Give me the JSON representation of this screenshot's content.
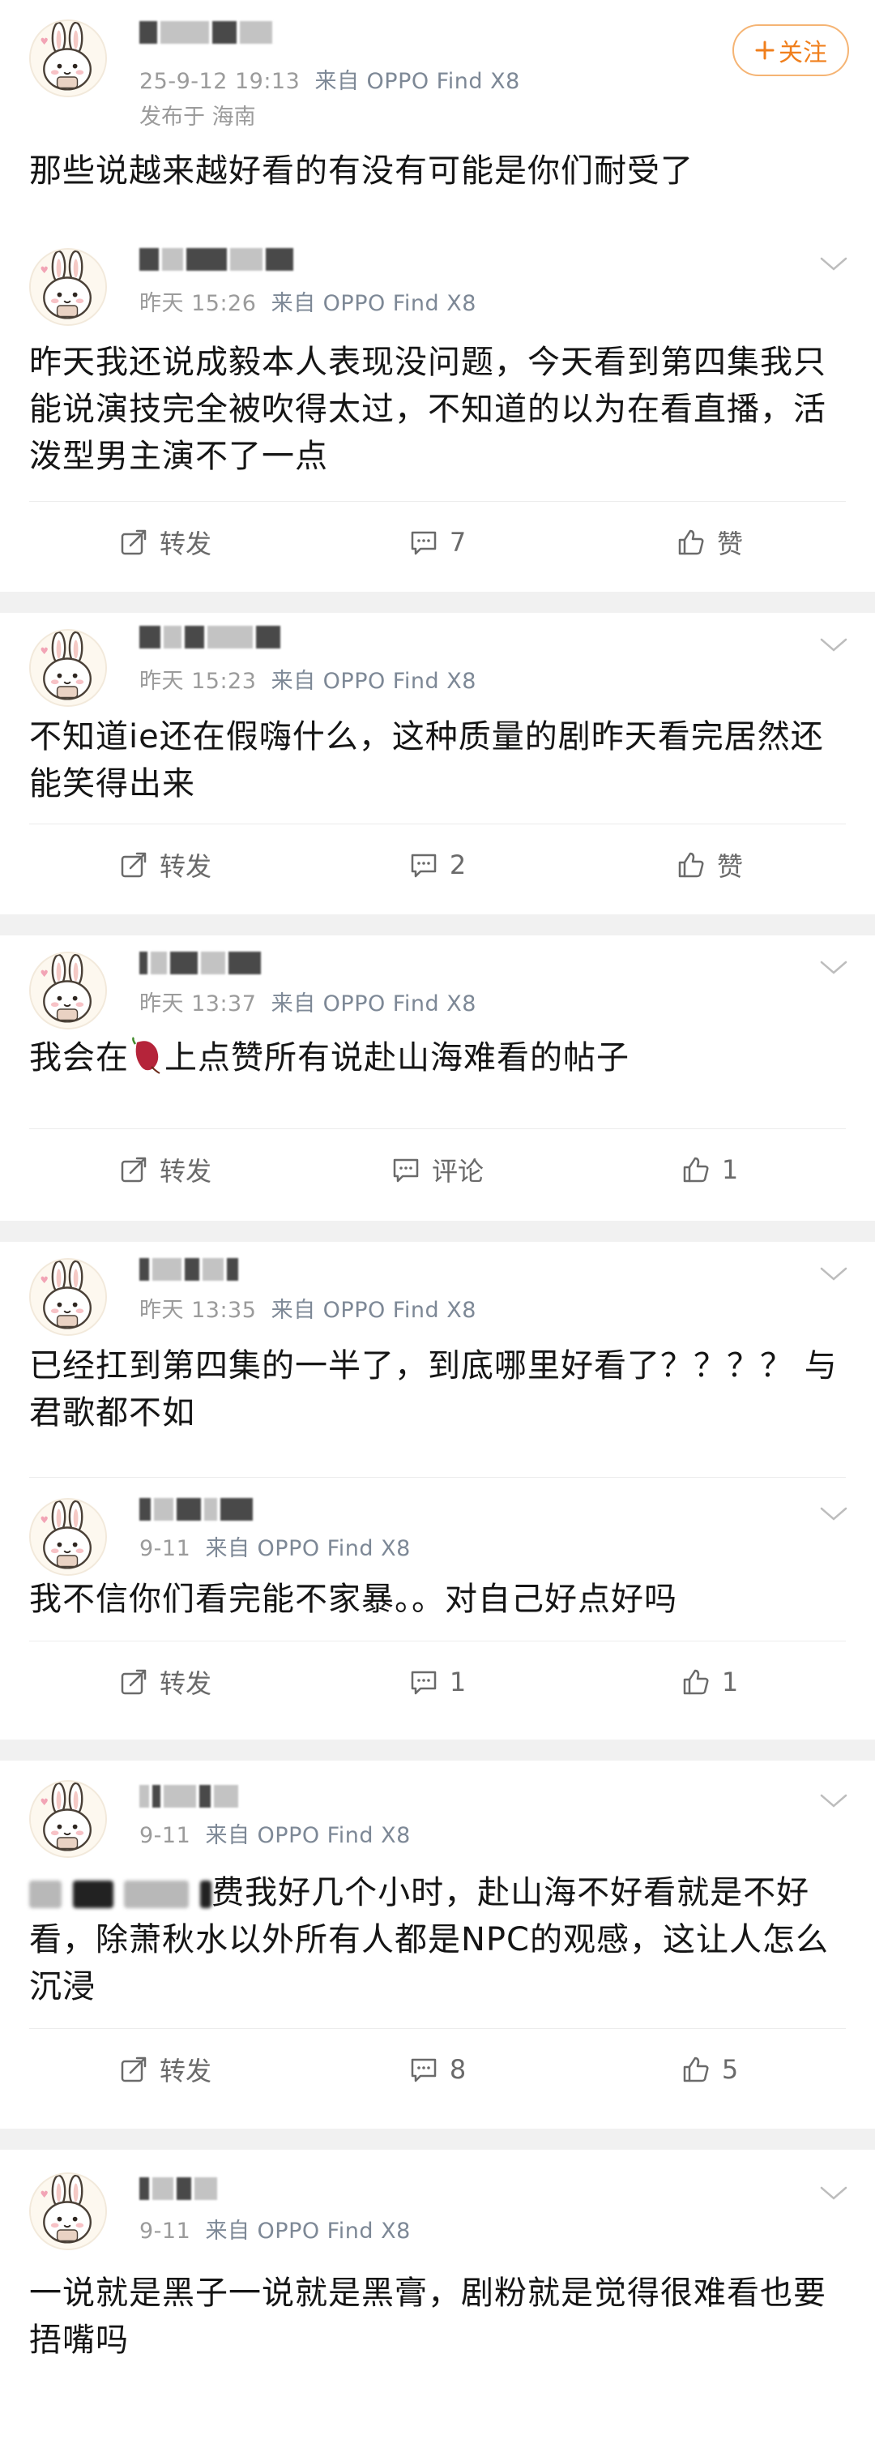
{
  "follow_label": "关注",
  "comments": [
    {
      "time": "25-9-12 19:13",
      "source": "来自 OPPO Find X8",
      "location": "发布于 海南",
      "text": "那些说越来越好看的有没有可能是你们耐受了"
    },
    {
      "time": "昨天 15:26",
      "source": "来自 OPPO Find X8",
      "text": "昨天我还说成毅本人表现没问题，今天看到第四集我只能说演技完全被吹得太过，不知道的以为在看直播，活泼型男主演不了一点",
      "actions": {
        "repost": "转发",
        "comment": "7",
        "like": "赞"
      }
    },
    {
      "time": "昨天 15:23",
      "source": "来自 OPPO Find X8",
      "text": "不知道ie还在假嗨什么，这种质量的剧昨天看完居然还能笑得出来",
      "actions": {
        "repost": "转发",
        "comment": "2",
        "like": "赞"
      }
    },
    {
      "time": "昨天 13:37",
      "source": "来自 OPPO Find X8",
      "text_before": "我会在",
      "text_after": "上点赞所有说赴山海难看的帖子",
      "actions": {
        "repost": "转发",
        "comment": "评论",
        "like": "1"
      }
    },
    {
      "time": "昨天 13:35",
      "source": "来自 OPPO Find X8",
      "text": "已经扛到第四集的一半了，到底哪里好看了？？？？ 与君歌都不如"
    },
    {
      "time": "9-11",
      "source": "来自 OPPO Find X8",
      "text": "我不信你们看完能不家暴。。对自己好点好吗",
      "actions": {
        "repost": "转发",
        "comment": "1",
        "like": "1"
      }
    },
    {
      "time": "9-11",
      "source": "来自 OPPO Find X8",
      "text": "费我好几个小时，赴山海不好看就是不好看，除萧秋水以外所有人都是NPC的观感，这让人怎么沉浸",
      "actions": {
        "repost": "转发",
        "comment": "8",
        "like": "5"
      }
    },
    {
      "time": "9-11",
      "source": "来自 OPPO Find X8",
      "text": "一说就是黑子一说就是黑膏，剧粉就是觉得很难看也要捂嘴吗"
    }
  ],
  "icons": [
    "repost-icon",
    "comment-icon",
    "like-icon",
    "chevron-down-icon",
    "plus-icon",
    "bunny-avatar"
  ]
}
